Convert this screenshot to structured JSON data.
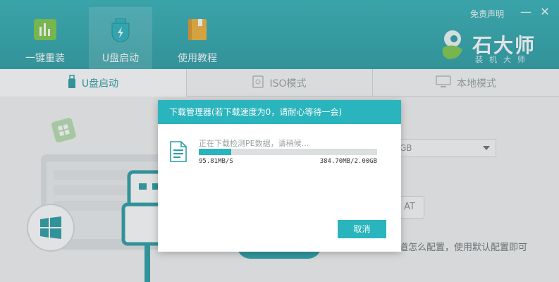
{
  "header": {
    "nav": [
      {
        "label": "一键重装",
        "icon": "bar-chart-icon"
      },
      {
        "label": "U盘启动",
        "icon": "usb-shield-icon"
      },
      {
        "label": "使用教程",
        "icon": "book-icon"
      }
    ],
    "disclaimer": "免责声明",
    "minimize": "—",
    "close": "✕",
    "logo": {
      "name": "石大师",
      "sub": "装机大师"
    }
  },
  "tabs": [
    {
      "label": "U盘启动",
      "icon": "usb-icon"
    },
    {
      "label": "ISO模式",
      "icon": "disc-icon"
    },
    {
      "label": "本地模式",
      "icon": "monitor-icon"
    }
  ],
  "background": {
    "dropdown_value": "GB",
    "side_button": "AT",
    "hint": "道怎么配置，使用默认配置即可"
  },
  "dialog": {
    "title": "下载管理器(若下载速度为0，请耐心等待一会)",
    "status": "正在下载检测PE数据，请稍候...",
    "progress": 0.18,
    "speed": "95.81MB/S",
    "amount": "384.70MB/2.00GB",
    "cancel": "取消"
  },
  "colors": {
    "brand": "#2ab4bd",
    "header": "#2a9ea5",
    "nav_icon_green": "#7ec84a",
    "nav_icon_orange": "#f0b23a"
  }
}
